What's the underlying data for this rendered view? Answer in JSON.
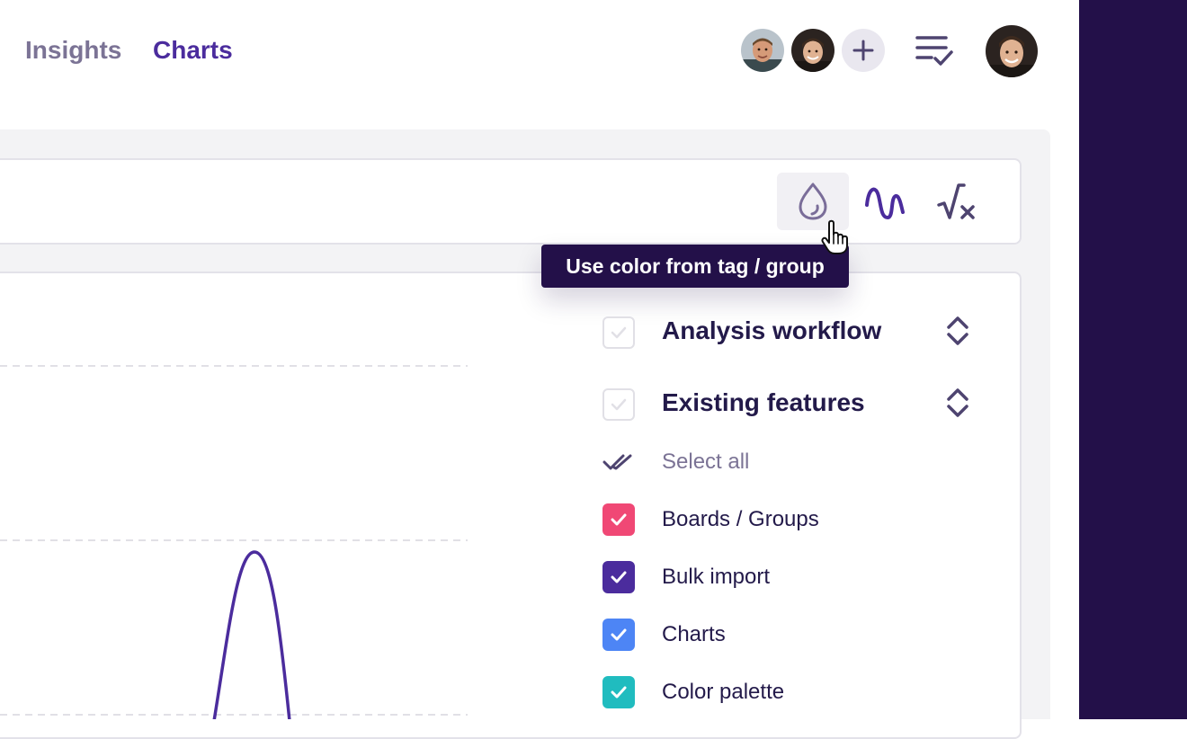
{
  "header": {
    "tabs": [
      {
        "label": "Insights",
        "active": false
      },
      {
        "label": "Charts",
        "active": true
      }
    ],
    "accent_color": "#4b2c9d"
  },
  "toolbar": {
    "buttons": [
      {
        "name": "color-from-tag",
        "icon": "drop-icon",
        "active": true
      },
      {
        "name": "curve-style",
        "icon": "wave-curve-icon"
      },
      {
        "name": "formula",
        "icon": "square-root-x-icon"
      }
    ]
  },
  "tooltip": {
    "text": "Use color from tag / group"
  },
  "filters": {
    "groups": [
      {
        "label": "Analysis workflow",
        "checked": false
      },
      {
        "label": "Existing features",
        "checked": false
      }
    ],
    "select_all_label": "Select all",
    "items": [
      {
        "label": "Boards / Groups",
        "color": "#f04875",
        "checked": true
      },
      {
        "label": "Bulk import",
        "color": "#4b2c9d",
        "checked": true
      },
      {
        "label": "Charts",
        "color": "#4d85f5",
        "checked": true
      },
      {
        "label": "Color palette",
        "color": "#20bcbf",
        "checked": true
      }
    ]
  },
  "colors": {
    "sidebar_dark": "#231049",
    "panel_bg": "#f3f3f5",
    "line_purple": "#4b2c9d"
  }
}
